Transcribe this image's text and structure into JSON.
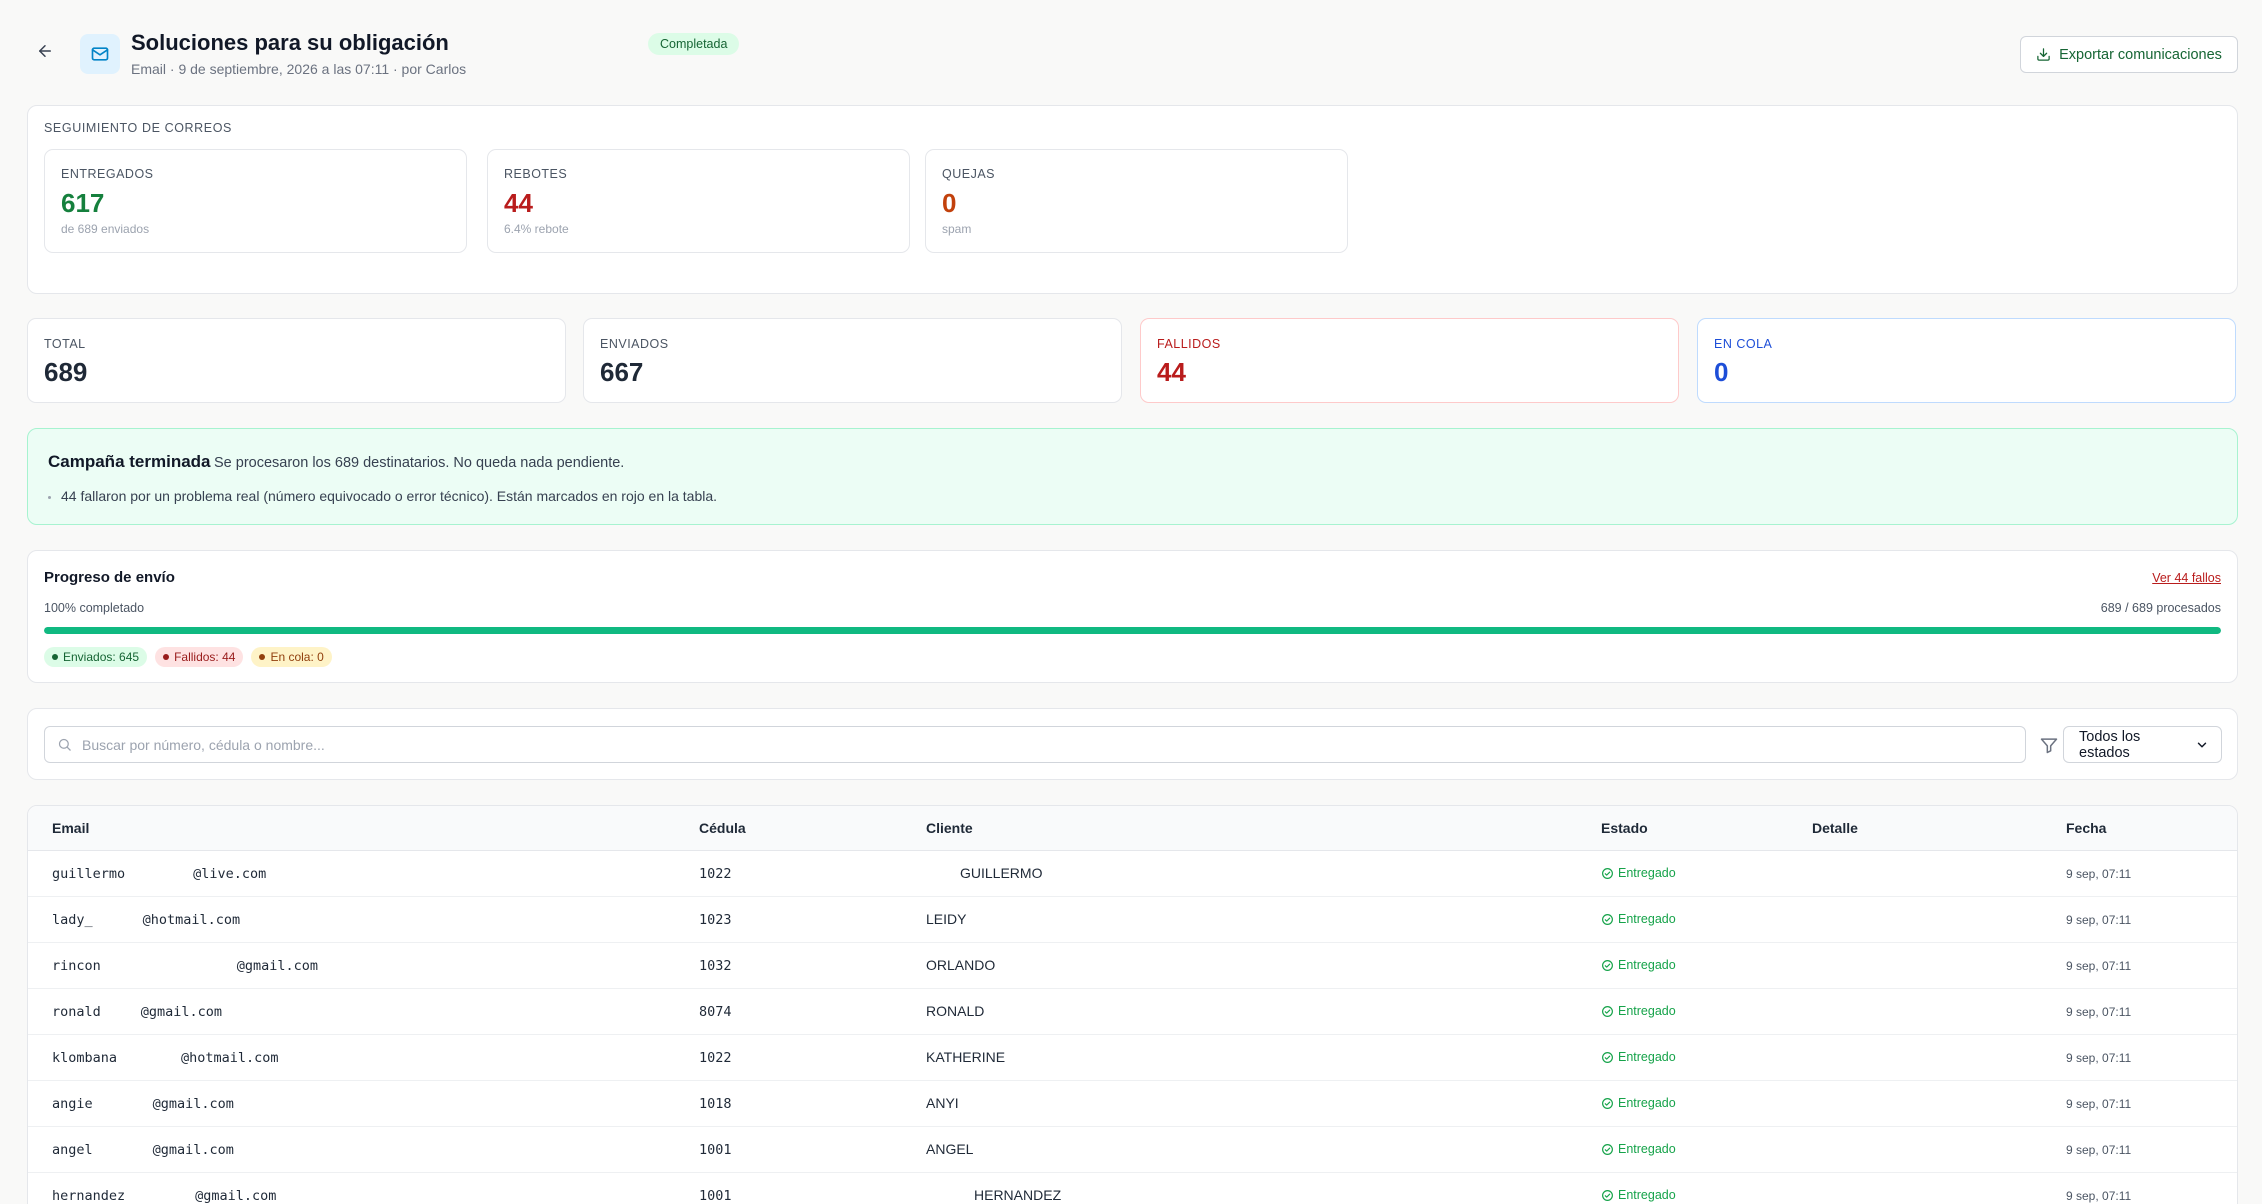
{
  "header": {
    "title": "Soluciones para su obligación",
    "subtitle": "Email · 9 de septiembre, 2026 a las 07:11 · por Carlos",
    "status": "Completada",
    "export_label": "Exportar comunicaciones"
  },
  "tracking": {
    "label": "SEGUIMIENTO DE CORREOS",
    "cards": [
      {
        "label": "ENTREGADOS",
        "value": "617",
        "sub": "de 689 enviados",
        "color": "#15803d"
      },
      {
        "label": "REBOTES",
        "value": "44",
        "sub": "6.4% rebote",
        "color": "#b91c1c"
      },
      {
        "label": "QUEJAS",
        "value": "0",
        "sub": "spam",
        "color": "#c2410c"
      }
    ]
  },
  "stats": [
    {
      "label": "TOTAL",
      "value": "689"
    },
    {
      "label": "ENVIADOS",
      "value": "667"
    },
    {
      "label": "FALLIDOS",
      "value": "44"
    },
    {
      "label": "EN COLA",
      "value": "0"
    }
  ],
  "notice": {
    "title": "Campaña terminada",
    "text": "Se procesaron los 689 destinatarios. No queda nada pendiente.",
    "bullet": "44 fallaron por un problema real (número equivocado o error técnico). Están marcados en rojo en la tabla."
  },
  "progress": {
    "title": "Progreso de envío",
    "link": "Ver 44 fallos",
    "pct_text": "100% completado",
    "count_text": "689 / 689 procesados",
    "fraction": 1.0,
    "chips": [
      {
        "label": "Enviados: 645"
      },
      {
        "label": "Fallidos: 44"
      },
      {
        "label": "En cola: 0"
      }
    ]
  },
  "filters": {
    "search_placeholder": "Buscar por número, cédula o nombre...",
    "status_value": "Todos los estados"
  },
  "table": {
    "headers": [
      "Email",
      "Cédula",
      "Cliente",
      "Estado",
      "Detalle",
      "Fecha"
    ],
    "rows": [
      {
        "email_user": "guillermo",
        "email_domain": "@live.com",
        "cedula": "1022",
        "cliente": "GUILLERMO",
        "estado": "Entregado",
        "detalle": "",
        "fecha": "9 sep, 07:11"
      },
      {
        "email_user": "lady_",
        "email_domain": "@hotmail.com",
        "cedula": "1023",
        "cliente": "LEIDY",
        "estado": "Entregado",
        "detalle": "",
        "fecha": "9 sep, 07:11"
      },
      {
        "email_user": "rincon",
        "email_domain": "@gmail.com",
        "cedula": "1032",
        "cliente": "ORLANDO",
        "estado": "Entregado",
        "detalle": "",
        "fecha": "9 sep, 07:11"
      },
      {
        "email_user": "ronald",
        "email_domain": "@gmail.com",
        "cedula": "8074",
        "cliente": "RONALD",
        "estado": "Entregado",
        "detalle": "",
        "fecha": "9 sep, 07:11"
      },
      {
        "email_user": "klombana",
        "email_domain": "@hotmail.com",
        "cedula": "1022",
        "cliente": "KATHERINE",
        "estado": "Entregado",
        "detalle": "",
        "fecha": "9 sep, 07:11"
      },
      {
        "email_user": "angie",
        "email_domain": "@gmail.com",
        "cedula": "1018",
        "cliente": "ANYI",
        "estado": "Entregado",
        "detalle": "",
        "fecha": "9 sep, 07:11"
      },
      {
        "email_user": "angel",
        "email_domain": "@gmail.com",
        "cedula": "1001",
        "cliente": "ANGEL",
        "estado": "Entregado",
        "detalle": "",
        "fecha": "9 sep, 07:11"
      },
      {
        "email_user": "hernandez",
        "email_domain": "@gmail.com",
        "cedula": "1001",
        "cliente": "HERNANDEZ",
        "estado": "Entregado",
        "detalle": "",
        "fecha": "9 sep, 07:11"
      }
    ]
  },
  "colors": {
    "accent_green": "#10b981",
    "fail_red": "#b91c1c",
    "queue_blue": "#1d4ed8"
  },
  "icons": [
    "arrow-left-icon",
    "mail-icon",
    "download-icon",
    "search-icon",
    "filter-icon",
    "chevron-down-icon",
    "check-circle-icon"
  ]
}
